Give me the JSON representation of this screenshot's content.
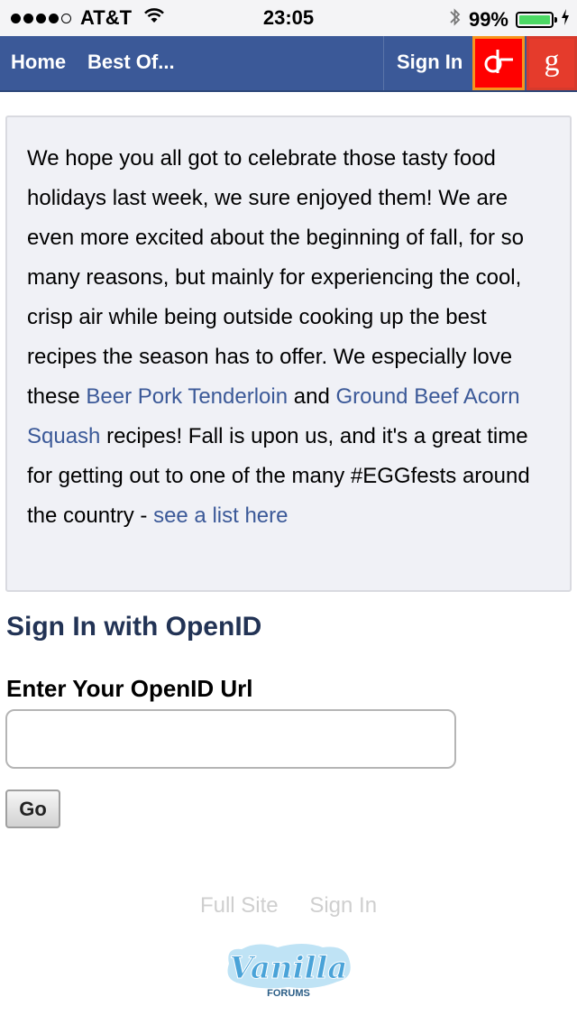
{
  "status_bar": {
    "carrier": "AT&T",
    "time": "23:05",
    "battery_percent": "99%",
    "battery_level": 0.99,
    "signal_bars_filled": 4,
    "signal_bars_total": 5
  },
  "navbar": {
    "home": "Home",
    "best_of": "Best Of...",
    "sign_in": "Sign In",
    "google_letter": "g",
    "color": "#3b5998",
    "openid_icon": "openid-icon",
    "google_icon": "google-icon"
  },
  "message": {
    "text_1": "We hope you all got to celebrate those tasty food holidays last week, we sure enjoyed them! We are even more excited about the beginning of fall, for so many reasons, but mainly for experiencing the cool, crisp air while being outside cooking up the best recipes the season has to offer. We especially love these ",
    "link_1": "Beer Pork Tenderloin",
    "text_2": " and ",
    "link_2": "Ground Beef Acorn Squash",
    "text_3": " recipes! Fall is upon us, and it's a great time for getting out to one of the many #EGGfests around the country - ",
    "link_3": "see a list here"
  },
  "signin": {
    "heading": "Sign In with OpenID",
    "label": "Enter Your OpenID Url",
    "input_value": "",
    "button": "Go"
  },
  "footer": {
    "full_site": "Full Site",
    "sign_in": "Sign In",
    "logo_text": "Vanilla",
    "logo_subtext": "FORUMS"
  }
}
